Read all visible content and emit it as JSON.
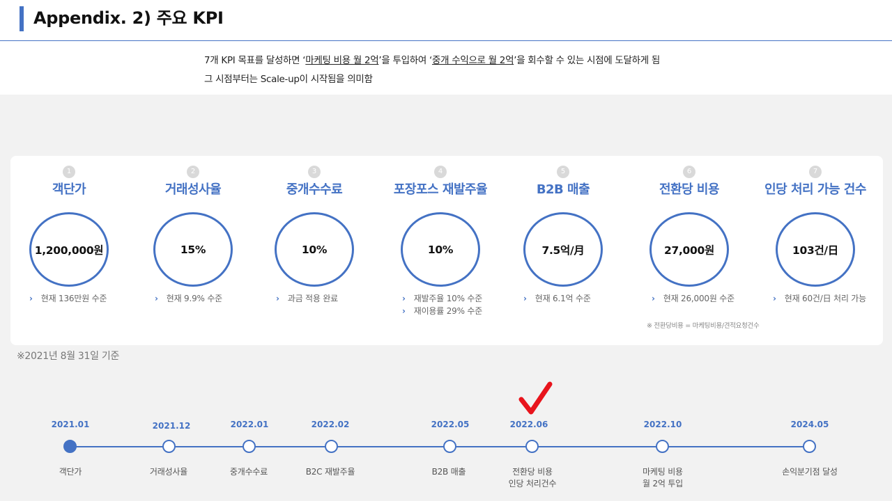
{
  "header": {
    "title": "Appendix. 2) 주요 KPI",
    "summary": {
      "line1_a": "7개 KPI 목표를 달성하면 ‘",
      "line1_u1": "마케팅 비용 월 2억",
      "line1_b": "’을 투입하여 ‘",
      "line1_u2": "중개 수익으로 월 2억",
      "line1_c": "’을 회수할 수 있는 시점에 도달하게 됨",
      "line2": "그 시점부터는 Scale-up이 시작됨을 의미함"
    }
  },
  "kpis": [
    {
      "num": "1",
      "name": "객단가",
      "value": "1,200,000원",
      "notes": [
        "현재 136만원 수준"
      ]
    },
    {
      "num": "2",
      "name": "거래성사율",
      "value": "15%",
      "notes": [
        "현재 9.9% 수준"
      ]
    },
    {
      "num": "3",
      "name": "중개수수료",
      "value": "10%",
      "notes": [
        "과금 적용 완료"
      ]
    },
    {
      "num": "4",
      "name": "포장포스 재발주율",
      "value": "10%",
      "notes": [
        "재발주율 10% 수준",
        "재이용률 29% 수준"
      ]
    },
    {
      "num": "5",
      "name": "B2B 매출",
      "value": "7.5억/月",
      "notes": [
        "현재 6.1억 수준"
      ]
    },
    {
      "num": "6",
      "name": "전환당 비용",
      "value": "27,000원",
      "notes": [
        "현재 26,000원 수준"
      ]
    },
    {
      "num": "7",
      "name": "인당 처리 가능 건수",
      "value": "103건/日",
      "notes": [
        "현재 60건/日 처리 가능"
      ]
    }
  ],
  "footnote_small": "※ 전환당비용 = 마케팅비용/견적요청건수",
  "as_of": "※2021년 8월 31일 기준",
  "colors": {
    "accent": "#4472c4",
    "check": "#e8141c",
    "background": "#f2f2f2"
  },
  "timeline": [
    {
      "date": "2021.01",
      "label": "객단가",
      "label2": "",
      "filled": true
    },
    {
      "date": "2021.12",
      "label": "거래성사율",
      "label2": "",
      "filled": false
    },
    {
      "date": "2022.01",
      "label": "중개수수료",
      "label2": "",
      "filled": false
    },
    {
      "date": "2022.02",
      "label": "B2C 재발주율",
      "label2": "",
      "filled": false
    },
    {
      "date": "2022.05",
      "label": "B2B 매출",
      "label2": "",
      "filled": false
    },
    {
      "date": "2022.06",
      "label": "전환당 비용",
      "label2": "인당 처리건수",
      "filled": false
    },
    {
      "date": "2022.10",
      "label": "마케팅 비용",
      "label2": "월 2억 투입",
      "filled": false
    },
    {
      "date": "2024.05",
      "label": "손익분기점 달성",
      "label2": "",
      "filled": false
    }
  ],
  "current_marker": "check-mark-icon"
}
